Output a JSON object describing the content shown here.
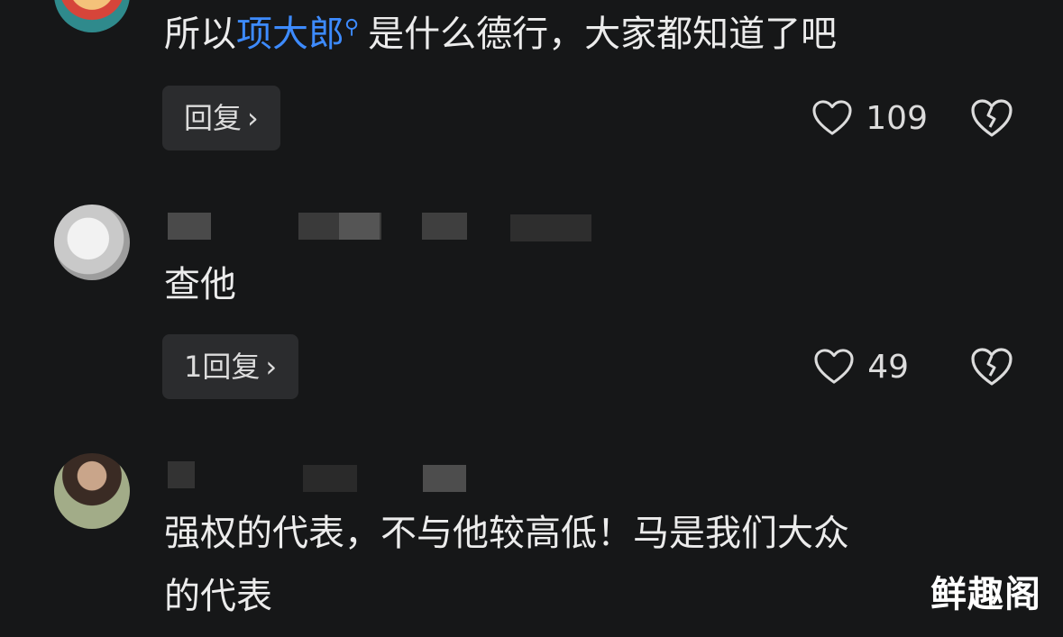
{
  "comments": [
    {
      "text_before": "所以",
      "mention": "项大郎",
      "mention_icon": "search-icon",
      "text_after": "是什么德行，大家都知道了吧",
      "reply_label": "回复",
      "likes": "109"
    },
    {
      "text": "查他",
      "reply_label": "1回复",
      "likes": "49"
    },
    {
      "text_line1": "强权的代表，不与他较高低！马是我们大众",
      "text_line2": "的代表"
    }
  ],
  "watermark": "鲜趣阁",
  "colors": {
    "background": "#161718",
    "mention": "#3d8bff",
    "reply_bg": "#2b2c2e"
  },
  "icons": {
    "like": "heart-outline-icon",
    "dislike": "broken-heart-icon",
    "chevron": "chevron-right-icon"
  }
}
